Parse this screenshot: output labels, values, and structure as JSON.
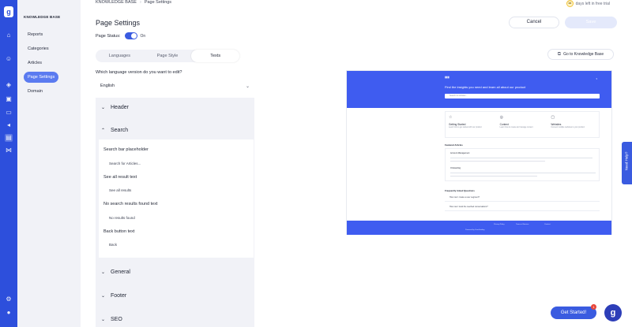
{
  "sidebar": {
    "title": "KNOWLEDGE BASE",
    "items": [
      {
        "label": "Reports"
      },
      {
        "label": "Categories"
      },
      {
        "label": "Articles"
      },
      {
        "label": "Page Settings"
      },
      {
        "label": "Domain"
      }
    ]
  },
  "header": {
    "breadcrumb": [
      "KNOWLEDGE BASE",
      "Page Settings"
    ],
    "trial_days": "14",
    "trial_text": "days left in free trial",
    "title": "Page Settings",
    "cancel_label": "Cancel",
    "save_label": "Save"
  },
  "status": {
    "label": "Page Status:",
    "state": "On"
  },
  "tabs": [
    {
      "label": "Languages"
    },
    {
      "label": "Page Style"
    },
    {
      "label": "Texts"
    }
  ],
  "goto_label": "Go to Knowledge Base",
  "language": {
    "question": "Which language version do you want to edit?",
    "value": "English"
  },
  "sections": [
    {
      "name": "Header"
    },
    {
      "name": "Search"
    },
    {
      "name": "General"
    },
    {
      "name": "Footer"
    },
    {
      "name": "SEO"
    }
  ],
  "search_fields": [
    {
      "label": "Search bar placeholder",
      "value": "Search for Articles..."
    },
    {
      "label": "See all result text",
      "value": "See all results"
    },
    {
      "label": "No search results found text",
      "value": "No results found"
    },
    {
      "label": "Back button text",
      "value": "Back"
    }
  ],
  "preview": {
    "heading": "Find the insights you need and learn all about our product",
    "search_placeholder": "Search for Articles...",
    "cards": [
      {
        "title": "Getting Started",
        "desc": "Learn how to get started with our product"
      },
      {
        "title": "Content",
        "desc": "Learn how to create and manage content"
      },
      {
        "title": "Websites",
        "desc": "Connect multiple websites to your product"
      }
    ],
    "featured_title": "Featured Articles",
    "articles": [
      "Account Management",
      "Onboarding"
    ],
    "faq_title": "Frequently Asked Questions",
    "faqs": [
      "How can I create a user segment?",
      "How can I track the reached conversations?"
    ],
    "footer_links": [
      "Privacy Policy",
      "Terms of Service",
      "Contact"
    ],
    "powered_by": "Powered by UserGuiding"
  },
  "help": {
    "need_help": "Need Help?",
    "get_started": "Get Started!",
    "badge": "1"
  }
}
